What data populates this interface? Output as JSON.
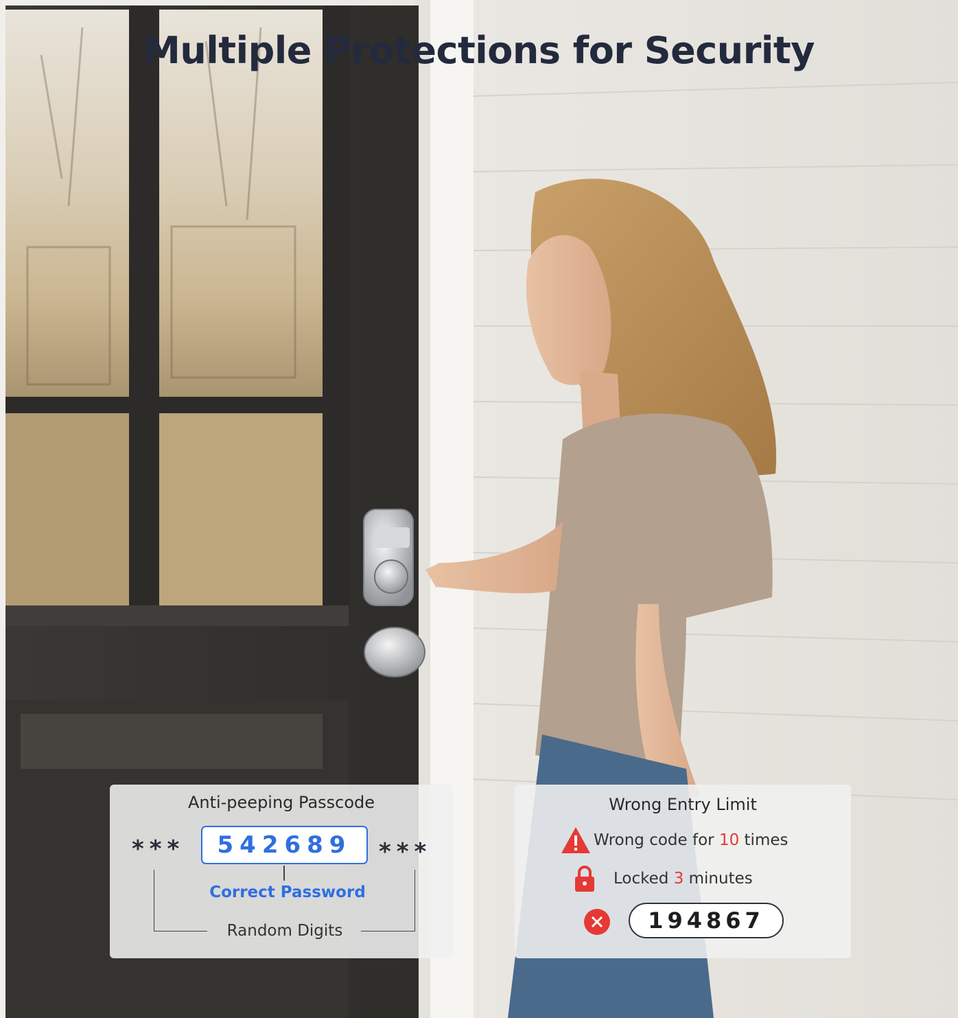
{
  "title": "Multiple Protections for Security",
  "anti_peeping": {
    "heading": "Anti-peeping Passcode",
    "stars_left": "***",
    "stars_right": "***",
    "passcode": "542689",
    "correct_label": "Correct Password",
    "random_label": "Random Digits",
    "accent_color": "#2f6fe0"
  },
  "wrong_entry": {
    "heading": "Wrong Entry Limit",
    "line1_prefix": "Wrong code for ",
    "line1_count": "10",
    "line1_suffix": " times",
    "line2_prefix": "Locked ",
    "line2_count": "3",
    "line2_suffix": " minutes",
    "code": "194867",
    "icons": [
      "warning-icon",
      "lock-icon",
      "error-x-icon"
    ],
    "alert_color": "#e53935"
  }
}
